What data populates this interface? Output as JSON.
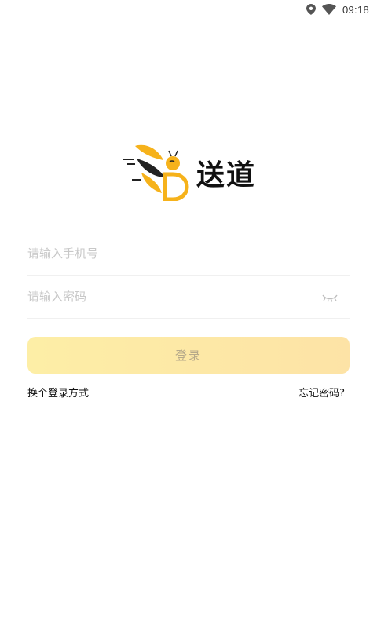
{
  "status_bar": {
    "time": "09:18",
    "icons": [
      "location-icon",
      "wifi-icon"
    ]
  },
  "brand": {
    "name": "送道",
    "logo_icon": "bee-logo-icon",
    "colors": {
      "yellow": "#f6b21b",
      "dark": "#222222"
    }
  },
  "form": {
    "phone_placeholder": "请输入手机号",
    "password_placeholder": "请输入密码",
    "password_toggle_icon": "eye-closed-icon"
  },
  "login_button": {
    "label": "登录",
    "background": "#fdeaa6"
  },
  "links": {
    "switch_method": "换个登录方式",
    "forgot_password": "忘记密码?"
  }
}
